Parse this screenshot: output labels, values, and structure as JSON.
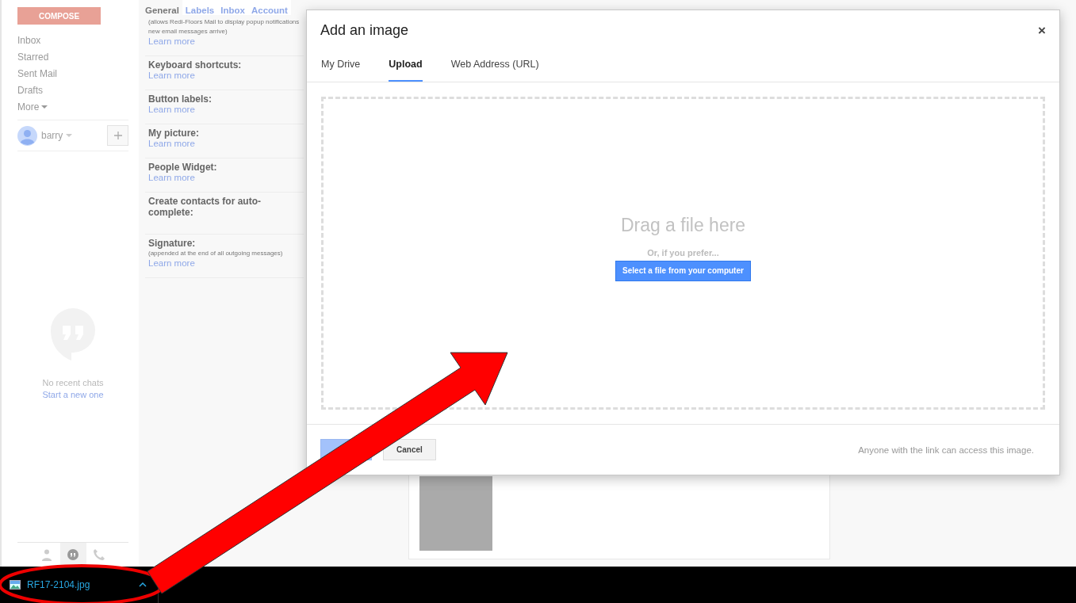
{
  "sidebar": {
    "compose": "COMPOSE",
    "nav": [
      {
        "label": "Inbox"
      },
      {
        "label": "Starred"
      },
      {
        "label": "Sent Mail"
      },
      {
        "label": "Drafts"
      },
      {
        "label": "More",
        "dropdown": true
      }
    ],
    "account": {
      "name": "barry"
    },
    "chat": {
      "empty_text": "No recent chats",
      "link": "Start a new one"
    },
    "chat_tabs": [
      {
        "kind": "person",
        "selected": false
      },
      {
        "kind": "chat",
        "selected": true
      },
      {
        "kind": "phone",
        "selected": false
      }
    ]
  },
  "settings": {
    "tabs": [
      {
        "label": "General",
        "selected": true
      },
      {
        "label": "Labels",
        "selected": false
      },
      {
        "label": "Inbox",
        "selected": false
      },
      {
        "label": "Account",
        "selected": false
      }
    ],
    "rows": [
      {
        "description_lines": [
          "(allows Redi-Floors Mail to display popup notifications",
          "new email messages arrive)"
        ],
        "link": "Learn more"
      },
      {
        "label": "Keyboard shortcuts:",
        "link": "Learn more"
      },
      {
        "label": "Button labels:",
        "link": "Learn more"
      },
      {
        "label": "My picture:",
        "link": "Learn more"
      },
      {
        "label": "People Widget:",
        "link": "Learn more"
      },
      {
        "label": "Create contacts for auto-complete:"
      },
      {
        "label": "Signature:",
        "description_lines": [
          "(appended at the end of all outgoing messages)"
        ],
        "link": "Learn more"
      }
    ]
  },
  "dialog": {
    "title": "Add an image",
    "close": "×",
    "tabs": [
      {
        "label": "My Drive",
        "selected": false
      },
      {
        "label": "Upload",
        "selected": true
      },
      {
        "label": "Web Address (URL)",
        "selected": false
      }
    ],
    "dropzone": {
      "heading": "Drag a file here",
      "subtext": "Or, if you prefer...",
      "button": "Select a file from your computer"
    },
    "footer": {
      "primary_disabled": true,
      "cancel": "Cancel",
      "note": "Anyone with the link can access this image."
    }
  },
  "taskbar": {
    "download": {
      "filename": "RF17-2104.jpg"
    }
  }
}
